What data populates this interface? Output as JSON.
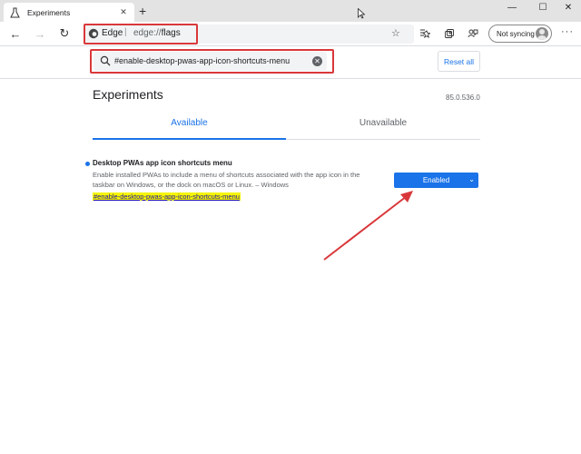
{
  "browser": {
    "tab_title": "Experiments",
    "tab_close": "✕",
    "new_tab": "+",
    "window_controls": {
      "minimize": "—",
      "maximize": "☐",
      "close": "✕"
    },
    "omnibox": {
      "scheme_label": "Edge",
      "separator": "|",
      "url_prefix": "edge://",
      "url_path": "flags"
    },
    "sync_label": "Not syncing",
    "more": "···"
  },
  "search": {
    "value": "#enable-desktop-pwas-app-icon-shortcuts-menu",
    "reset_label": "Reset all"
  },
  "page": {
    "title": "Experiments",
    "version": "85.0.536.0",
    "tabs": [
      {
        "label": "Available"
      },
      {
        "label": "Unavailable"
      }
    ]
  },
  "flag": {
    "name": "Desktop PWAs app icon shortcuts menu",
    "description": "Enable installed PWAs to include a menu of shortcuts associated with the app icon in the taskbar on Windows, or the dock on macOS or Linux. – Windows",
    "link": "#enable-desktop-pwas-app-icon-shortcuts-menu",
    "state": "Enabled"
  },
  "colors": {
    "accent": "#1a73e8",
    "annotation": "#d9383a",
    "highlight": "#f5f500"
  }
}
